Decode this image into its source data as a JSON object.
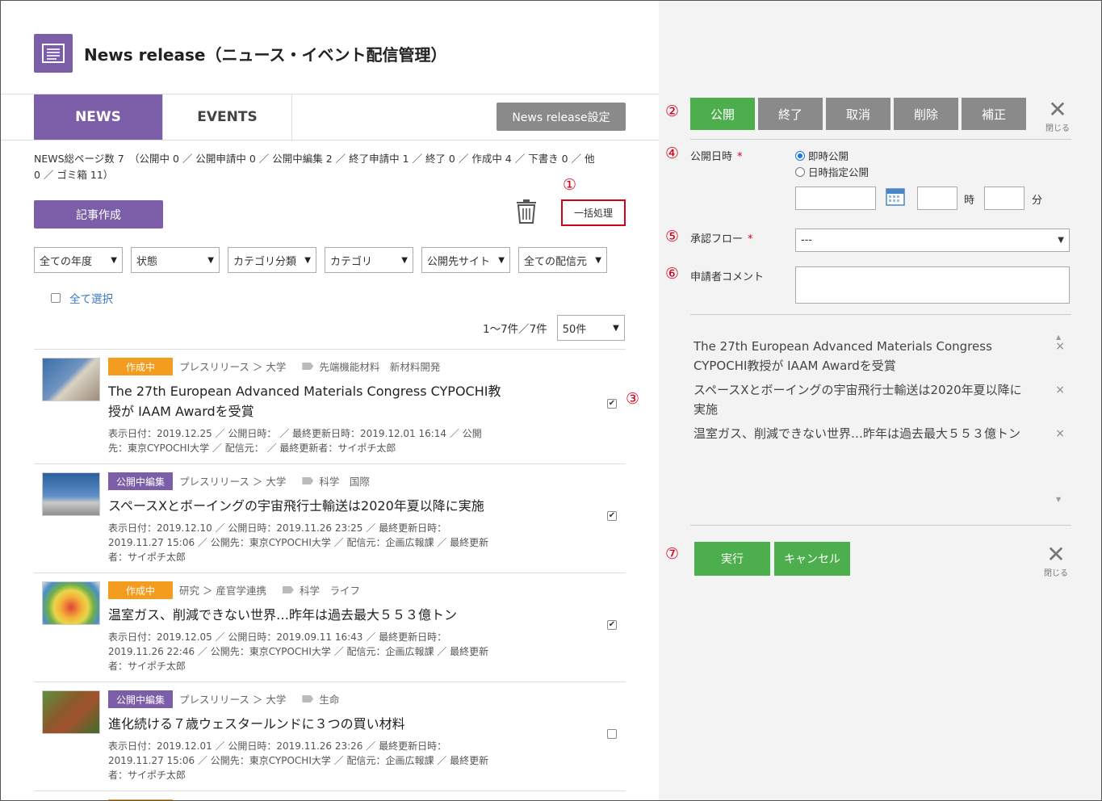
{
  "page": {
    "title": "News release（ニュース・イベント配信管理）"
  },
  "tabs": [
    {
      "label": "NEWS",
      "active": true
    },
    {
      "label": "EVENTS",
      "active": false
    }
  ],
  "settings_button": "News release設定",
  "summary_line1": "NEWS総ページ数 7　（公開中 0 ／ 公開申請中 0 ／ 公開中編集 2 ／ 終了申請中 1 ／ 終了 0 ／ 作成中 4 ／ 下書き 0 ／ 他",
  "summary_line2": "0 ／ ゴミ箱 11）",
  "create_button": "記事作成",
  "bulk_button": "一括処理",
  "filters": [
    {
      "label": "全ての年度"
    },
    {
      "label": "状態"
    },
    {
      "label": "カテゴリ分類"
    },
    {
      "label": "カテゴリ"
    },
    {
      "label": "公開先サイト"
    },
    {
      "label": "全ての配信元"
    }
  ],
  "select_all_label": "全て選択",
  "paging": {
    "range": "1〜7件／7件",
    "per_page": "50件"
  },
  "articles": [
    {
      "status": "作成中",
      "status_color": "#f39c1e",
      "category": "プレスリリース ＞ 大学",
      "tags": "先端機能材料　新材料開発",
      "title1": "The 27th European Advanced Materials Congress CYPOCHI教",
      "title2": "授が IAAM Awardを受賞",
      "meta1": "表示日付：2019.12.25 ／ 公開日時：  ／ 最終更新日時：2019.12.01 16:14 ／ 公開",
      "meta2": "先：東京CYPOCHI大学 ／ 配信元：  ／ 最終更新者：サイポチ太郎",
      "meta3": "",
      "checked": true
    },
    {
      "status": "公開中編集",
      "status_color": "#7b5ea7",
      "category": "プレスリリース ＞ 大学",
      "tags": "科学　国際",
      "title1": "スペースXとボーイングの宇宙飛行士輸送は2020年夏以降に実施",
      "title2": "",
      "meta1": "表示日付：2019.12.10 ／ 公開日時：2019.11.26 23:25 ／ 最終更新日時：",
      "meta2": "2019.11.27 15:06 ／ 公開先：東京CYPOCHI大学 ／ 配信元：企画広報課 ／ 最終更新",
      "meta3": "者：サイポチ太郎",
      "checked": true
    },
    {
      "status": "作成中",
      "status_color": "#f39c1e",
      "category": "研究 ＞ 産官学連携",
      "tags": "科学　ライフ",
      "title1": "温室ガス、削減できない世界…昨年は過去最大５５３億トン",
      "title2": "",
      "meta1": "表示日付：2019.12.05 ／ 公開日時：2019.09.11 16:43 ／ 最終更新日時：",
      "meta2": "2019.11.26 22:46 ／ 公開先：東京CYPOCHI大学 ／ 配信元：企画広報課 ／ 最終更新",
      "meta3": "者：サイポチ太郎",
      "checked": true
    },
    {
      "status": "公開中編集",
      "status_color": "#7b5ea7",
      "category": "プレスリリース ＞ 大学",
      "tags": "生命",
      "title1": "進化続ける７歳ウェスタールンドに３つの買い材料",
      "title2": "",
      "meta1": "表示日付：2019.12.01 ／ 公開日時：2019.11.26 23:26 ／ 最終更新日時：",
      "meta2": "2019.11.27 15:06 ／ 公開先：東京CYPOCHI大学 ／ 配信元：企画広報課 ／ 最終更新",
      "meta3": "者：サイポチ太郎",
      "checked": false
    }
  ],
  "marks": {
    "m1": "①",
    "m2": "②",
    "m3": "③",
    "m4": "④",
    "m5": "⑤",
    "m6": "⑥",
    "m7": "⑦"
  },
  "panel": {
    "actions": [
      "公開",
      "終了",
      "取消",
      "削除",
      "補正"
    ],
    "close_label": "閉じる",
    "publish_date_label": "公開日時",
    "required_mark": "*",
    "radio_immediate": "即時公開",
    "radio_scheduled": "日時指定公開",
    "hour_unit": "時",
    "minute_unit": "分",
    "flow_label": "承認フロー",
    "flow_value": "---",
    "comment_label": "申請者コメント",
    "selected_items": [
      {
        "line1": "The 27th European Advanced Materials Congress",
        "line2": "CYPOCHI教授が IAAM Awardを受賞"
      },
      {
        "line1": "スペースXとボーイングの宇宙飛行士輸送は2020年夏以降に",
        "line2": "実施"
      },
      {
        "line1": "温室ガス、削減できない世界…昨年は過去最大５５３億トン",
        "line2": ""
      }
    ],
    "remove_symbol": "×",
    "execute_button": "実行",
    "cancel_button": "キャンセル"
  }
}
